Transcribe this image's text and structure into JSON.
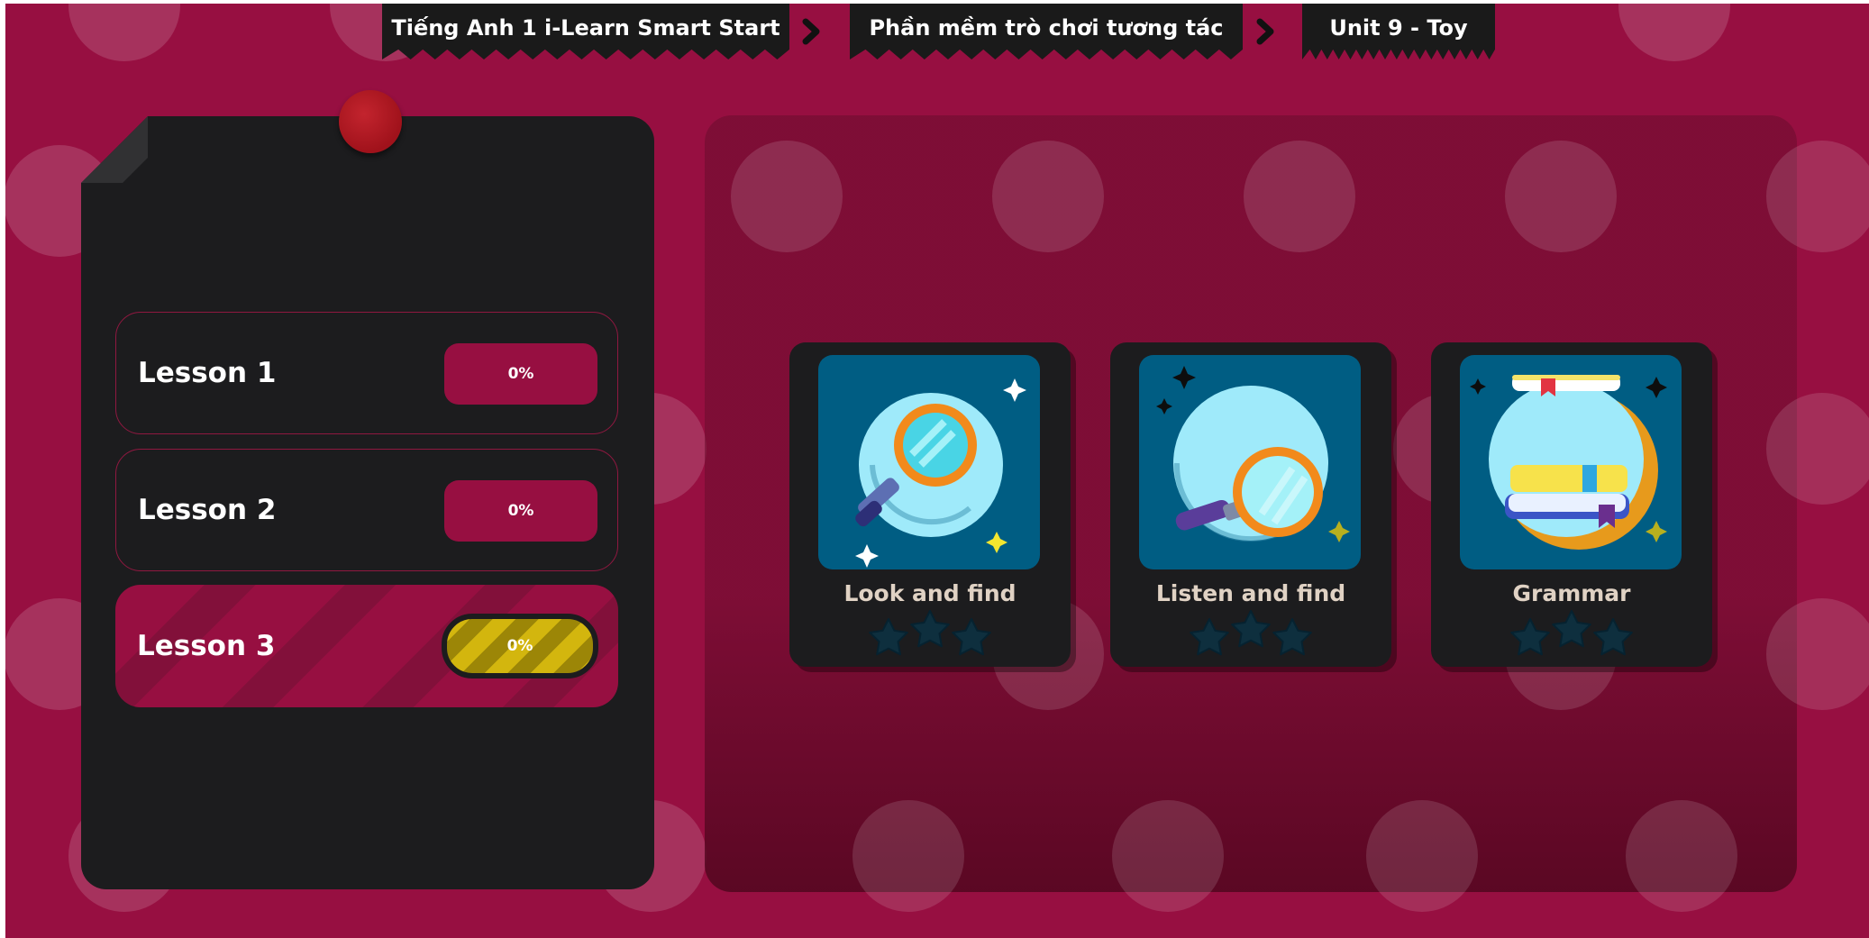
{
  "breadcrumb": {
    "items": [
      {
        "label": "Tiếng Anh 1 i-Learn Smart Start"
      },
      {
        "label": "Phần mềm trò chơi tương tác"
      },
      {
        "label": "Unit 9 - Toy"
      }
    ]
  },
  "lessons": [
    {
      "label": "Lesson 1",
      "progress": "0%",
      "progress_value": 0
    },
    {
      "label": "Lesson 2",
      "progress": "0%",
      "progress_value": 0
    },
    {
      "label": "Lesson 3",
      "progress": "0%",
      "progress_value": 0
    }
  ],
  "active_lesson": "Lesson 3",
  "activities": [
    {
      "title": "Look and find",
      "icon": "magnifier-icon",
      "stars_earned": 0,
      "stars_total": 3
    },
    {
      "title": "Listen and find",
      "icon": "magnifier-icon",
      "stars_earned": 0,
      "stars_total": 3
    },
    {
      "title": "Grammar",
      "icon": "books-icon",
      "stars_earned": 0,
      "stars_total": 3
    }
  ],
  "colors": {
    "background": "#970f41",
    "panel": "#1c1c1e",
    "card_art": "#005d83",
    "progress_pill": "#970f41",
    "active_progress": "#d3b60e",
    "star_empty": "#0e2f3e"
  }
}
